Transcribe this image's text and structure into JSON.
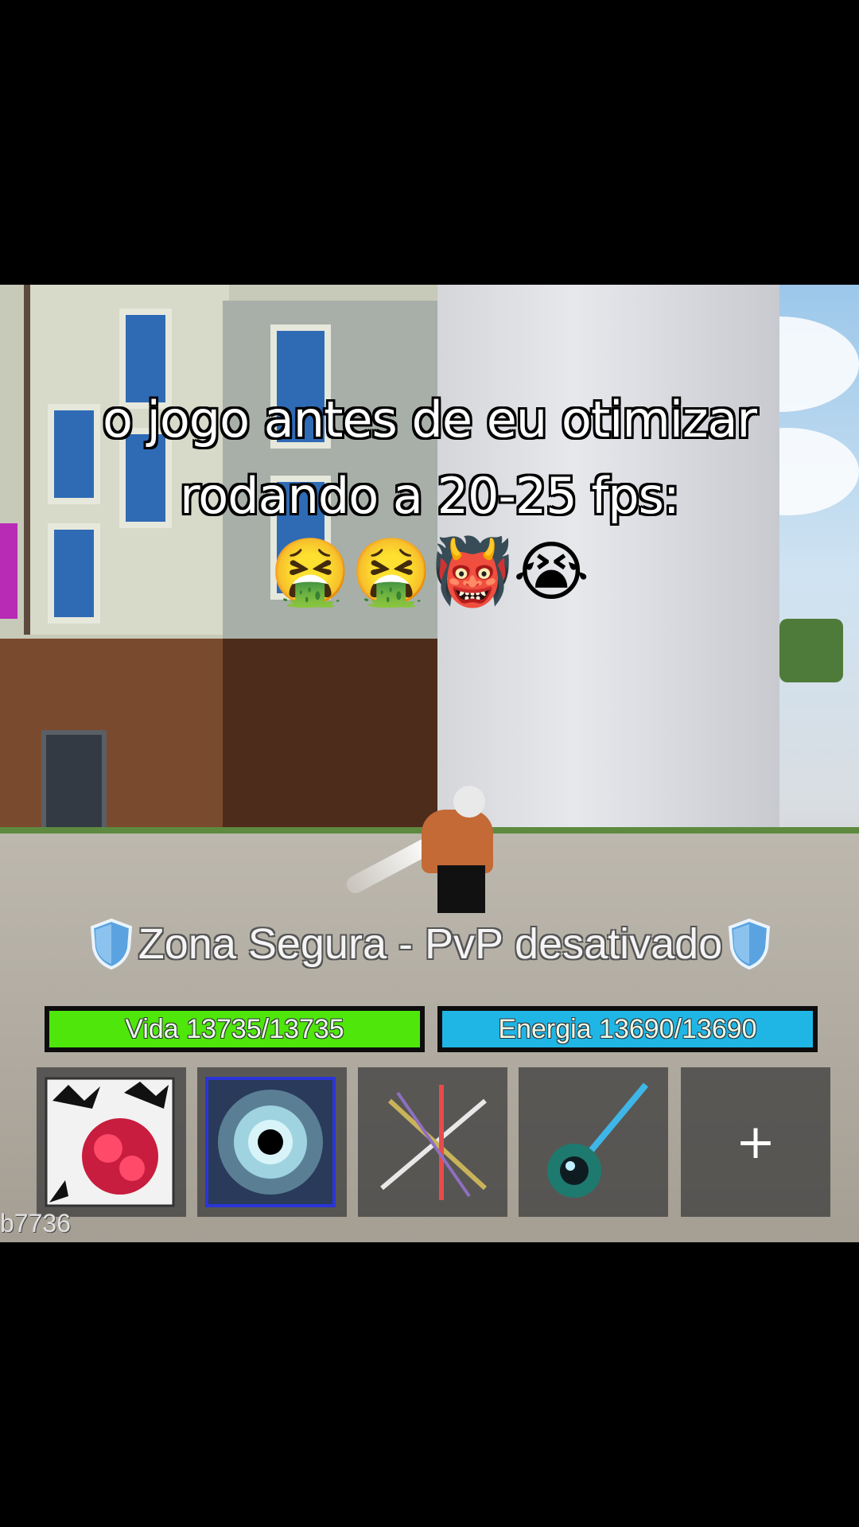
{
  "caption": {
    "line1": "o jogo antes de eu otimizar",
    "line2": "rodando a 20-25 fps:",
    "emojis": "🤮🤮👹😭"
  },
  "hud": {
    "zone_text": "Zona Segura - PvP desativado",
    "health_label": "Vida 13735/13735",
    "health": {
      "current": 13735,
      "max": 13735
    },
    "energy_label": "Energia 13690/13690",
    "energy": {
      "current": 13690,
      "max": 13690
    },
    "hotbar": [
      {
        "item": "fruit-icon"
      },
      {
        "item": "black-hole-icon"
      },
      {
        "item": "crossed-swords-icon"
      },
      {
        "item": "trident-icon"
      },
      {
        "item": "add-slot",
        "label": "+"
      }
    ],
    "user_tag": "b7736"
  },
  "colors": {
    "health_bar": "#4ee60b",
    "energy_bar": "#1fb6e6",
    "shield": "#5aa3e0"
  }
}
